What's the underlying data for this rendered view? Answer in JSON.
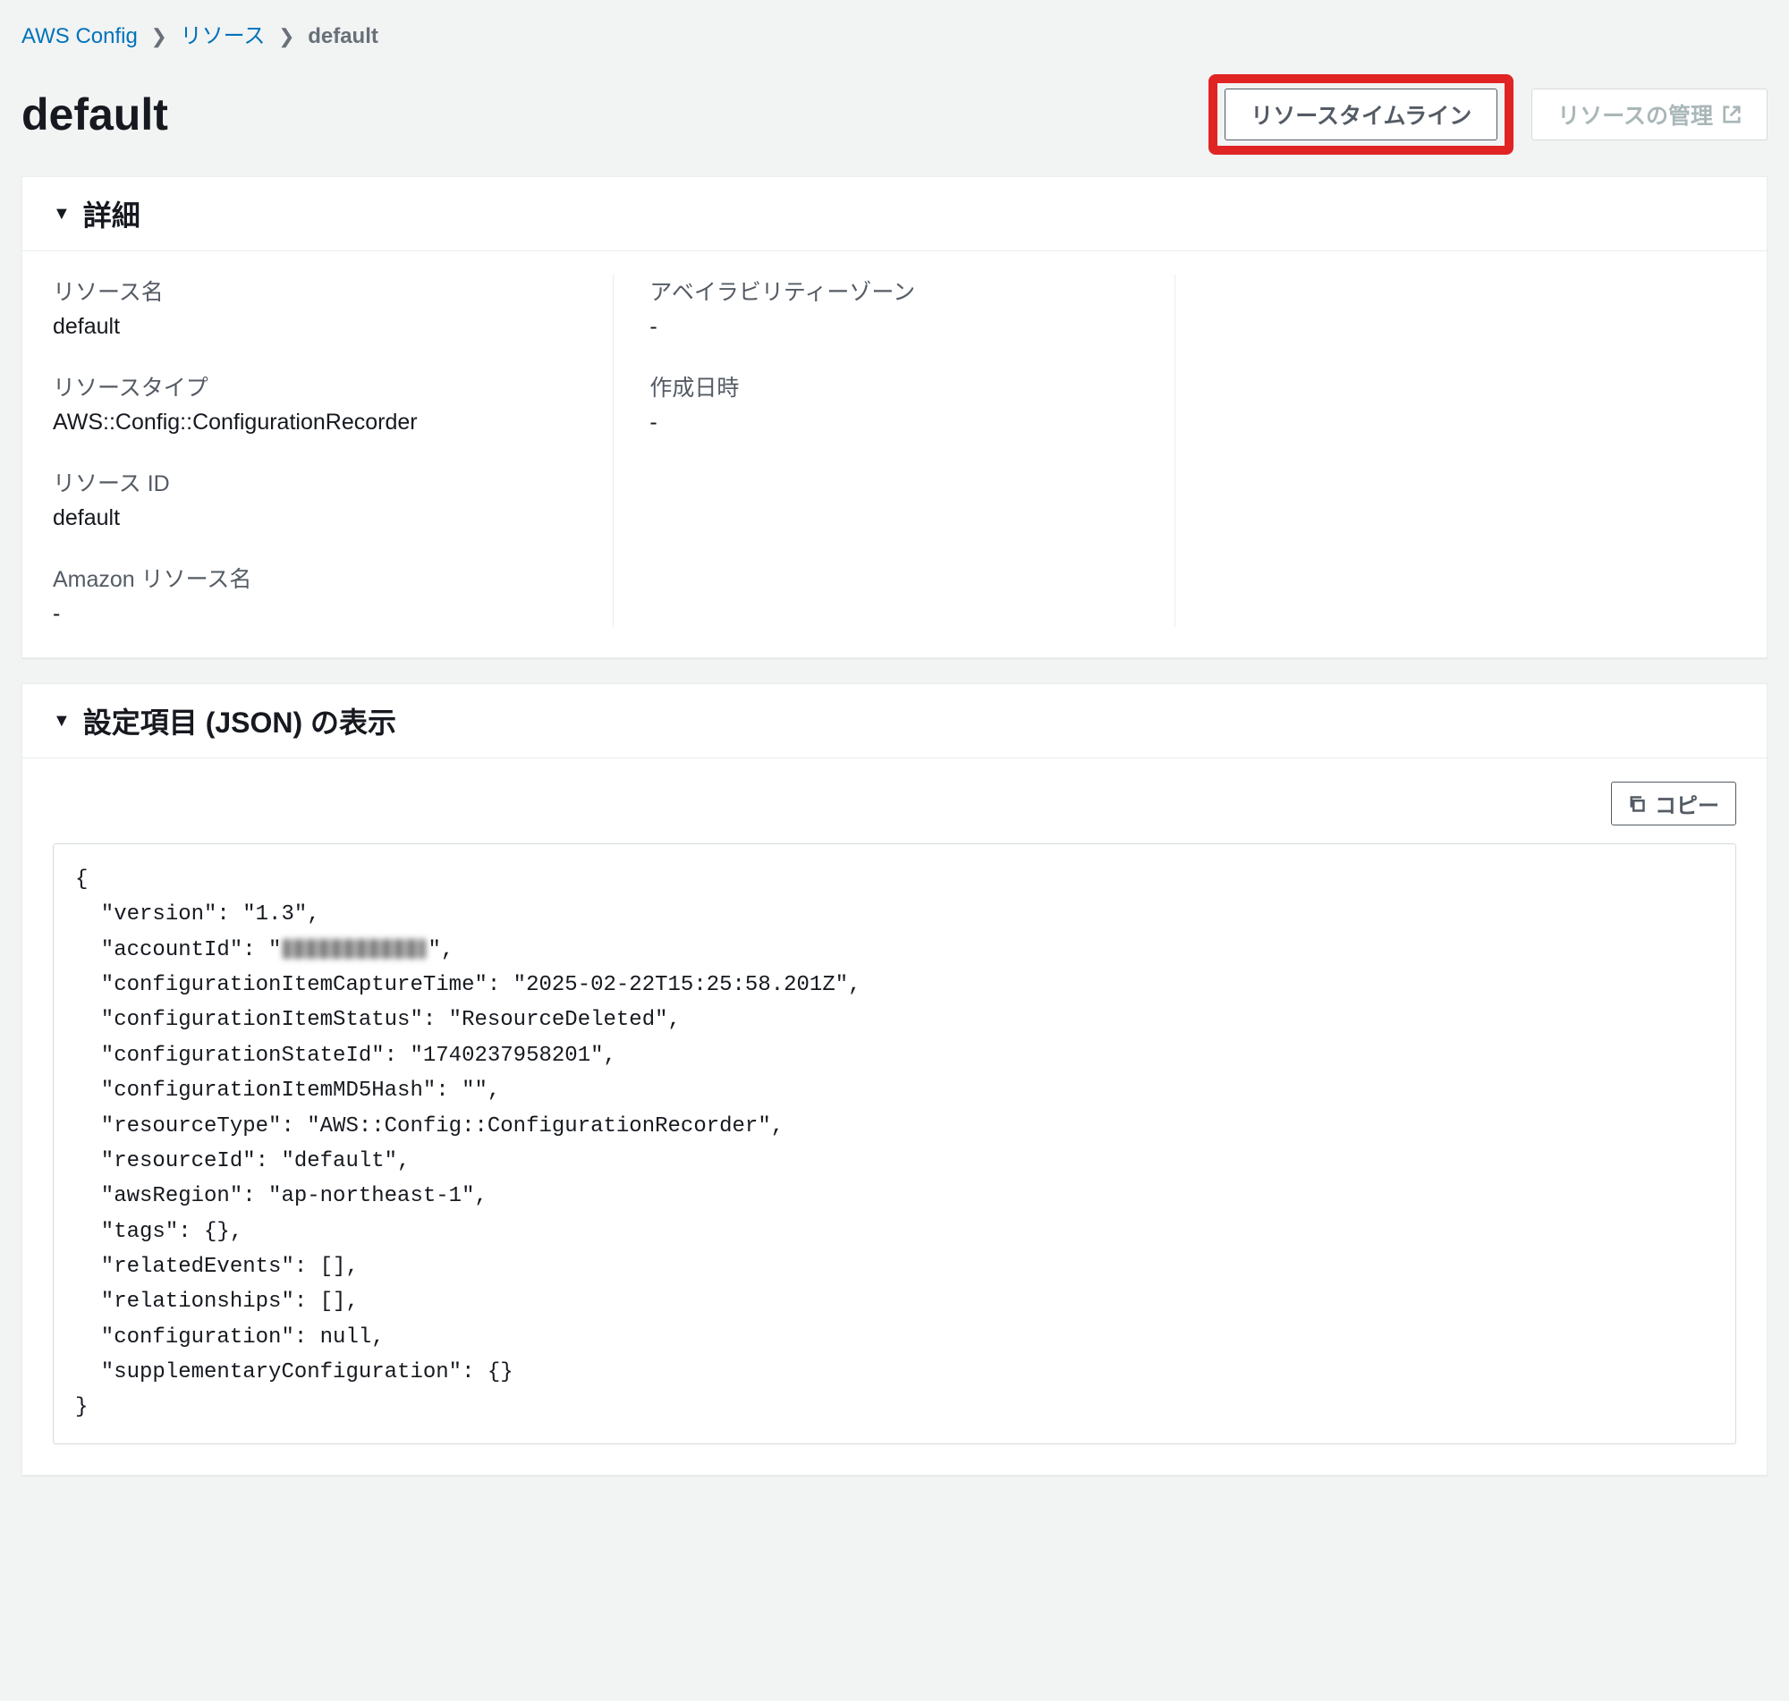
{
  "breadcrumb": {
    "root": "AWS Config",
    "resources": "リソース",
    "current": "default"
  },
  "page": {
    "title": "default",
    "timeline_button": "リソースタイムライン",
    "manage_button": "リソースの管理"
  },
  "details": {
    "header": "詳細",
    "resource_name_label": "リソース名",
    "resource_name_value": "default",
    "resource_type_label": "リソースタイプ",
    "resource_type_value": "AWS::Config::ConfigurationRecorder",
    "resource_id_label": "リソース ID",
    "resource_id_value": "default",
    "arn_label": "Amazon リソース名",
    "arn_value": "-",
    "az_label": "アベイラビリティーゾーン",
    "az_value": "-",
    "created_label": "作成日時",
    "created_value": "-"
  },
  "config_json": {
    "header": "設定項目 (JSON) の表示",
    "copy_button": "コピー",
    "redacted_account_id": "[redacted]",
    "code_prefix": "{\n  \"version\": \"1.3\",\n  \"accountId\": \"",
    "code_suffix": "\",\n  \"configurationItemCaptureTime\": \"2025-02-22T15:25:58.201Z\",\n  \"configurationItemStatus\": \"ResourceDeleted\",\n  \"configurationStateId\": \"1740237958201\",\n  \"configurationItemMD5Hash\": \"\",\n  \"resourceType\": \"AWS::Config::ConfigurationRecorder\",\n  \"resourceId\": \"default\",\n  \"awsRegion\": \"ap-northeast-1\",\n  \"tags\": {},\n  \"relatedEvents\": [],\n  \"relationships\": [],\n  \"configuration\": null,\n  \"supplementaryConfiguration\": {}\n}"
  }
}
